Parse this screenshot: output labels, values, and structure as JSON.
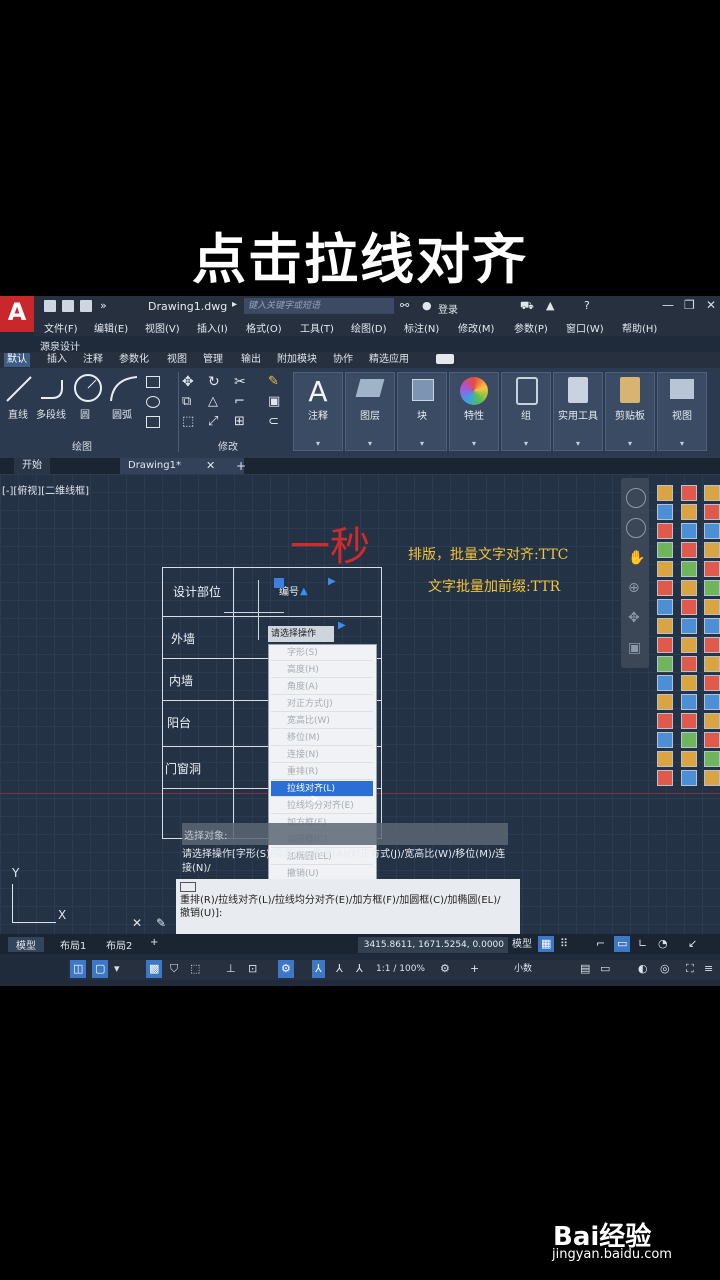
{
  "caption": "点击拉线对齐",
  "titlebar": {
    "logo_text": "A",
    "document_title": "Drawing1.dwg",
    "search_placeholder": "键入关键字或短语",
    "login": "登录",
    "window_buttons": [
      "—",
      "❐",
      "✕"
    ]
  },
  "menubar": {
    "items": [
      "文件(F)",
      "编辑(E)",
      "视图(V)",
      "插入(I)",
      "格式(O)",
      "工具(T)",
      "绘图(D)",
      "标注(N)",
      "修改(M)",
      "参数(P)",
      "窗口(W)",
      "帮助(H)"
    ],
    "second_row": "源泉设计"
  },
  "ribbon_tabs": {
    "items": [
      "默认",
      "插入",
      "注释",
      "参数化",
      "视图",
      "管理",
      "输出",
      "附加模块",
      "协作",
      "精选应用"
    ],
    "active_index": 0
  },
  "ribbon": {
    "draw_tools": [
      "直线",
      "多段线",
      "圆",
      "圆弧"
    ],
    "draw_section": "绘图",
    "modify_section": "修改",
    "big_buttons": [
      "注释",
      "图层",
      "块",
      "特性",
      "组",
      "实用工具",
      "剪贴板",
      "视图"
    ]
  },
  "file_tabs": {
    "start": "开始",
    "drawing": "Drawing1*",
    "close": "✕",
    "add": "+"
  },
  "viewport_label": "[-][俯视][二维线框]",
  "overlay": {
    "red_text": "一秒",
    "note_1": "排版，批量文字对齐:TTC",
    "note_2": "文字批量加前缀:TTR"
  },
  "table": {
    "rows": [
      "设计部位",
      "外墙",
      "内墙",
      "阳台",
      "门窗洞"
    ],
    "header_value": "编号"
  },
  "context_menu": {
    "header": "请选择操作",
    "items": [
      "字形(S)",
      "高度(H)",
      "角度(A)",
      "对正方式(J)",
      "宽高比(W)",
      "移位(M)",
      "连接(N)",
      "重排(R)",
      "拉线对齐(L)",
      "拉线均分对齐(E)",
      "加方框(F)",
      "加圆框(C)",
      "加椭圆(EL)",
      "撤销(U)"
    ],
    "selected_index": 8
  },
  "command_line": {
    "prompt": "选择对象:",
    "history": "请选择操作[字形(S)/高度(H)/角度(A)/对正方式(J)/宽高比(W)/移位(M)/连接(N)/",
    "current": "重排(R)/拉线对齐(L)/拉线均分对齐(E)/加方框(F)/加圆框(C)/加椭圆(EL)/撤销(U)]:"
  },
  "ucs": {
    "x": "X",
    "y": "Y"
  },
  "layout_tabs": [
    "模型",
    "布局1",
    "布局2",
    "+"
  ],
  "status": {
    "coordinates": "3415.8611, 1671.5254, 0.0000",
    "model": "模型",
    "scale": "1:1 / 100%",
    "units": "小数"
  },
  "watermark": {
    "logo": "Bai经验",
    "url": "jingyan.baidu.com"
  },
  "colors": {
    "accent_blue": "#2b6fd4",
    "annotation_yellow": "#f2c437",
    "overlay_red": "#d12a2a",
    "background": "#243245"
  }
}
